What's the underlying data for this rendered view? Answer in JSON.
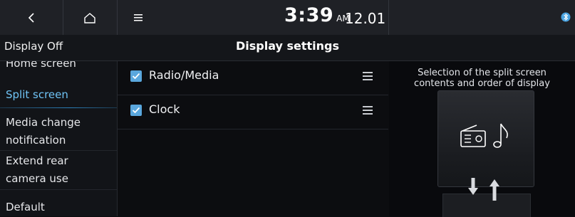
{
  "status_bar": {
    "back_icon": "chevron-left-icon",
    "home_icon": "home-icon",
    "menu_icon": "hamburger-menu-icon",
    "time": "3:39",
    "ampm": "AM",
    "date": "12.01",
    "status_icon": "bluetooth-icon"
  },
  "header": {
    "display_off": "Display Off",
    "title": "Display settings"
  },
  "sidebar": {
    "items": [
      {
        "label": "Home screen",
        "active": false
      },
      {
        "label": "Split screen",
        "active": true
      },
      {
        "label": "Media change\nnotification",
        "active": false
      },
      {
        "label": "Extend rear\ncamera use",
        "active": false
      },
      {
        "label": "Default",
        "active": false
      }
    ]
  },
  "split_list": {
    "items": [
      {
        "label": "Radio/Media",
        "checked": true
      },
      {
        "label": "Clock",
        "checked": true
      }
    ]
  },
  "preview": {
    "description": "Selection of the split screen\ncontents and order of display",
    "icons": [
      "radio-icon",
      "music-note-icon"
    ],
    "arrows": "swap-order-arrows-icon"
  },
  "colors": {
    "accent": "#6fc3f5",
    "checkbox": "#5aa7dd",
    "background": "#0c0d10"
  }
}
